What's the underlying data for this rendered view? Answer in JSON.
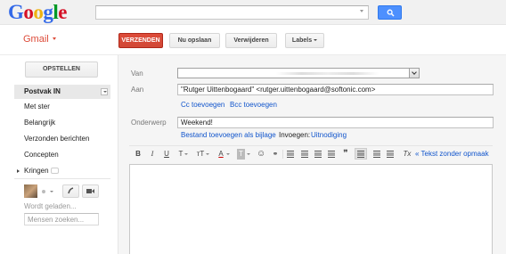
{
  "logo": [
    "G",
    "o",
    "o",
    "g",
    "l",
    "e"
  ],
  "search": {
    "value": "",
    "placeholder": ""
  },
  "app_title": "Gmail",
  "actions": {
    "send": "VERZENDEN",
    "save": "Nu opslaan",
    "discard": "Verwijderen",
    "labels": "Labels"
  },
  "sidebar": {
    "compose": "OPSTELLEN",
    "items": [
      "Postvak IN",
      "Met ster",
      "Belangrijk",
      "Verzonden berichten",
      "Concepten",
      "Kringen"
    ],
    "loading": "Wordt geladen...",
    "people_search_placeholder": "Mensen zoeken..."
  },
  "compose": {
    "from_label": "Van",
    "to_label": "Aan",
    "to_value": "\"Rutger Uittenbogaard\" <rutger.uittenbogaard@softonic.com>",
    "cc_link": "Cc toevoegen",
    "bcc_link": "Bcc toevoegen",
    "subject_label": "Onderwerp",
    "subject_value": "Weekend!",
    "attach_link": "Bestand toevoegen als bijlage",
    "insert_label": "Invoegen:",
    "invite_link": "Uitnodiging",
    "plain_text_link": "« Tekst zonder opmaak"
  },
  "toolbar_glyphs": {
    "bold": "B",
    "italic": "I",
    "underline": "U",
    "font": "T",
    "size": "тT",
    "color": "A",
    "bg": "T",
    "emoticon": "☺",
    "link": "⚭",
    "quote": "❞",
    "clear": "Tx"
  },
  "colors": {
    "send": "#d14836",
    "search": "#4d90fe",
    "gmail": "#dd4b39",
    "link": "#1155cc"
  }
}
